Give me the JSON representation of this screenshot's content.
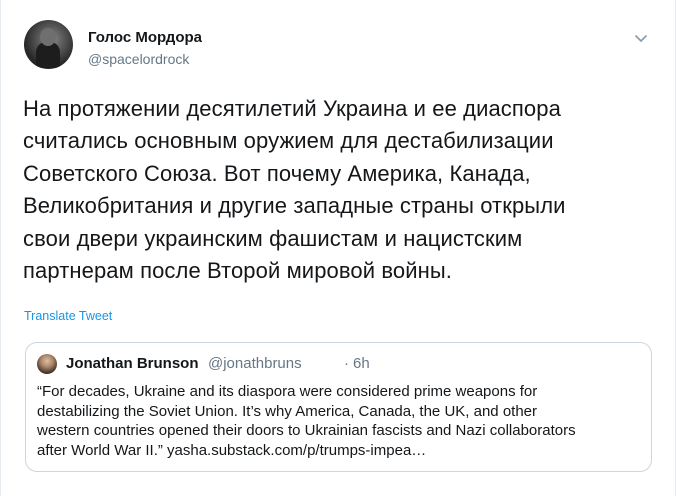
{
  "tweet": {
    "author_name": "Голос Мордора",
    "author_handle": "@spacelordrock",
    "text_lines": [
      "На протяжении десятилетий Украина и ее диаспора",
      "считались основным оружием для дестабилизации",
      "Советского Союза. Вот почему Америка, Канада,",
      "Великобритания и другие западные страны открыли",
      "свои двери украинским фашистам и нацистским",
      "партнерам после Второй мировой войны."
    ],
    "translate_label": "Translate Tweet",
    "menu_icon": "chevron-down-icon"
  },
  "quote": {
    "author_name": "Jonathan Brunson",
    "author_handle": "@jonathbruns",
    "separator": "·",
    "time": "6h",
    "text_lines": [
      "“For decades, Ukraine and its diaspora were considered prime weapons for",
      "destabilizing the Soviet Union. It’s why America, Canada, the UK, and other",
      "western countries opened their doors to Ukrainian fascists and Nazi collaborators",
      "after World War II.” yasha.substack.com/p/trumps-impea…"
    ]
  },
  "colors": {
    "link": "#1b95e0",
    "secondary_text": "#657786",
    "border": "#ccd6dd"
  }
}
